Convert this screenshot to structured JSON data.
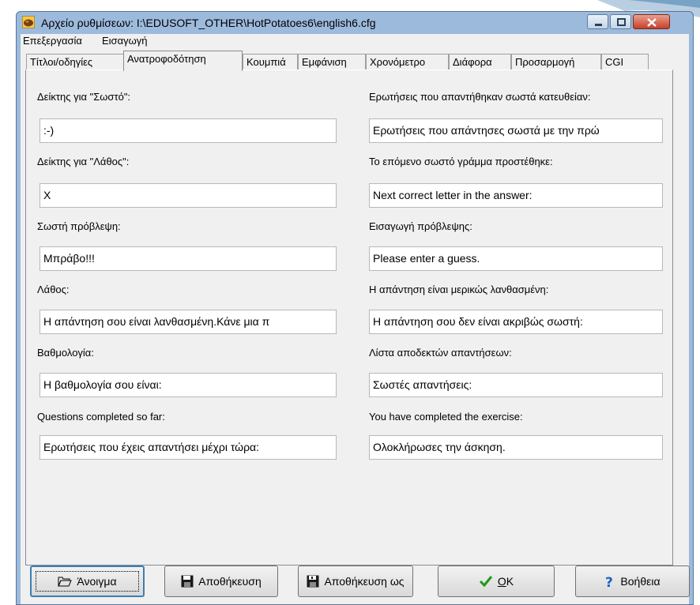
{
  "window": {
    "title": "Αρχείο ρυθμίσεων:  I:\\EDUSOFT_OTHER\\HotPotatoes6\\english6.cfg",
    "controls": [
      "minimize-icon",
      "maximize-icon",
      "close-icon"
    ]
  },
  "menu": [
    "Επεξεργασία",
    "Εισαγωγή"
  ],
  "tabs": [
    "Τίτλοι/οδηγίες",
    "Ανατροφοδότηση",
    "Κουμπιά",
    "Εμφάνιση",
    "Χρονόμετρο",
    "Διάφορα",
    "Προσαρμογή",
    "CGI"
  ],
  "active_tab": "Ανατροφοδότηση",
  "fields_left": [
    {
      "label": "Δείκτης για \"Σωστό\":",
      "value": ":-)"
    },
    {
      "label": "Δείκτης για \"Λάθος\":",
      "value": "X"
    },
    {
      "label": "Σωστή πρόβλεψη:",
      "value": "Μπράβο!!!"
    },
    {
      "label": "Λάθος:",
      "value": "Η απάντηση σου είναι λανθασμένη.Κάνε μια π"
    },
    {
      "label": "Βαθμολογία:",
      "value": "Η βαθμολογία σου είναι:"
    },
    {
      "label": "Questions completed so far:",
      "value": "Ερωτήσεις που έχεις απαντήσει μέχρι τώρα:"
    }
  ],
  "fields_right": [
    {
      "label": "Ερωτήσεις που απαντήθηκαν σωστά κατευθείαν:",
      "value": "Ερωτήσεις που απάντησες σωστά με την πρώ"
    },
    {
      "label": "Το επόμενο σωστό γράμμα προστέθηκε:",
      "value": "Next correct letter in the answer:"
    },
    {
      "label": "Εισαγωγή πρόβλεψης:",
      "value": "Please enter a guess."
    },
    {
      "label": "Η απάντηση είναι μερικώς λανθασμένη:",
      "value": "Η απάντηση σου δεν είναι ακριβώς σωστή:"
    },
    {
      "label": "Λίστα αποδεκτών απαντήσεων:",
      "value": "Σωστές απαντήσεις:"
    },
    {
      "label": "You have completed the exercise:",
      "value": "Ολοκλήρωσες την άσκηση."
    }
  ],
  "buttons": [
    {
      "label": "Άνοιγμα",
      "icon": "folder-open-icon"
    },
    {
      "label": "Αποθήκευση",
      "icon": "floppy-disk-icon"
    },
    {
      "label": "Αποθήκευση ως",
      "icon": "floppy-disk-save-as-icon"
    },
    {
      "label_underlined": "O",
      "label_rest": "K",
      "icon": "check-mark-icon"
    },
    {
      "label": "Βοήθεια",
      "icon": "help-question-icon"
    }
  ],
  "colors": {
    "titlebar": "#9cbadc",
    "close": "#c74027",
    "face": "#f0f0f0",
    "check": "#1a9a1a",
    "help": "#1b5fc4"
  }
}
